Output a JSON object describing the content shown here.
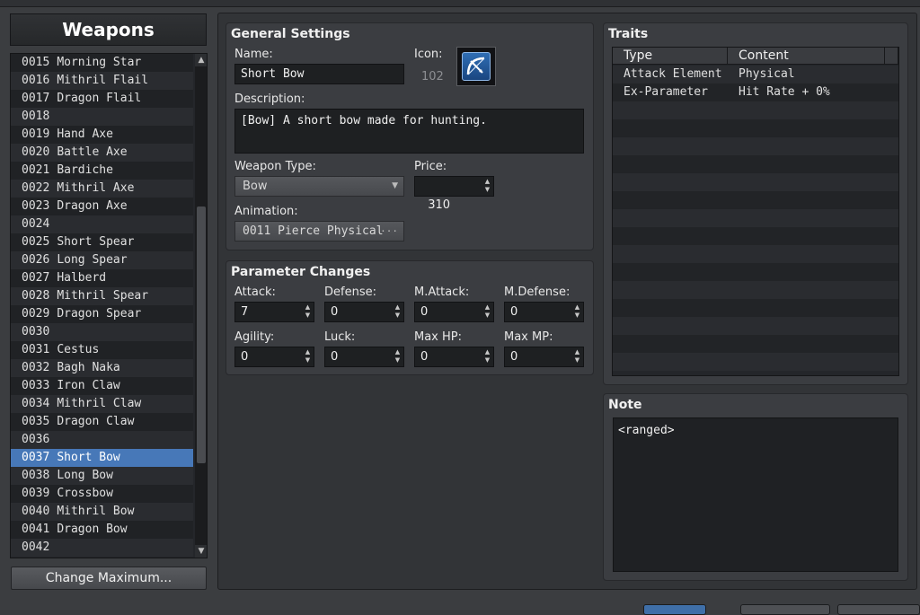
{
  "window": {
    "title": "Weapons"
  },
  "weapon_list": {
    "items": [
      {
        "id": "0015",
        "name": "Morning Star"
      },
      {
        "id": "0016",
        "name": "Mithril Flail"
      },
      {
        "id": "0017",
        "name": "Dragon Flail"
      },
      {
        "id": "0018",
        "name": ""
      },
      {
        "id": "0019",
        "name": "Hand Axe"
      },
      {
        "id": "0020",
        "name": "Battle Axe"
      },
      {
        "id": "0021",
        "name": "Bardiche"
      },
      {
        "id": "0022",
        "name": "Mithril Axe"
      },
      {
        "id": "0023",
        "name": "Dragon Axe"
      },
      {
        "id": "0024",
        "name": ""
      },
      {
        "id": "0025",
        "name": "Short Spear"
      },
      {
        "id": "0026",
        "name": "Long Spear"
      },
      {
        "id": "0027",
        "name": "Halberd"
      },
      {
        "id": "0028",
        "name": "Mithril Spear"
      },
      {
        "id": "0029",
        "name": "Dragon Spear"
      },
      {
        "id": "0030",
        "name": ""
      },
      {
        "id": "0031",
        "name": "Cestus"
      },
      {
        "id": "0032",
        "name": "Bagh Naka"
      },
      {
        "id": "0033",
        "name": "Iron Claw"
      },
      {
        "id": "0034",
        "name": "Mithril Claw"
      },
      {
        "id": "0035",
        "name": "Dragon Claw"
      },
      {
        "id": "0036",
        "name": ""
      },
      {
        "id": "0037",
        "name": "Short Bow"
      },
      {
        "id": "0038",
        "name": "Long Bow"
      },
      {
        "id": "0039",
        "name": "Crossbow"
      },
      {
        "id": "0040",
        "name": "Mithril Bow"
      },
      {
        "id": "0041",
        "name": "Dragon Bow"
      },
      {
        "id": "0042",
        "name": ""
      }
    ],
    "selected_id": "0037",
    "change_max_label": "Change Maximum..."
  },
  "general": {
    "title": "General Settings",
    "name_label": "Name:",
    "name_value": "Short Bow",
    "icon_label": "Icon:",
    "icon_index": "102",
    "description_label": "Description:",
    "description_value": "[Bow] A short bow made for hunting.",
    "weapon_type_label": "Weapon Type:",
    "weapon_type_value": "Bow",
    "price_label": "Price:",
    "price_value": "310",
    "animation_label": "Animation:",
    "animation_value": "0011 Pierce Physical",
    "animation_ellipsis": "···"
  },
  "params": {
    "title": "Parameter Changes",
    "items": [
      {
        "label": "Attack:",
        "value": "7"
      },
      {
        "label": "Defense:",
        "value": "0"
      },
      {
        "label": "M.Attack:",
        "value": "0"
      },
      {
        "label": "M.Defense:",
        "value": "0"
      },
      {
        "label": "Agility:",
        "value": "0"
      },
      {
        "label": "Luck:",
        "value": "0"
      },
      {
        "label": "Max HP:",
        "value": "0"
      },
      {
        "label": "Max MP:",
        "value": "0"
      }
    ]
  },
  "traits": {
    "title": "Traits",
    "col_type": "Type",
    "col_content": "Content",
    "rows": [
      {
        "type": "Attack Element",
        "content": "Physical"
      },
      {
        "type": "Ex-Parameter",
        "content": "Hit Rate + 0%"
      }
    ]
  },
  "note": {
    "title": "Note",
    "value": "<ranged>"
  },
  "colors": {
    "selection": "#4778b8",
    "panel": "#3b3d41",
    "background": "#323437"
  }
}
